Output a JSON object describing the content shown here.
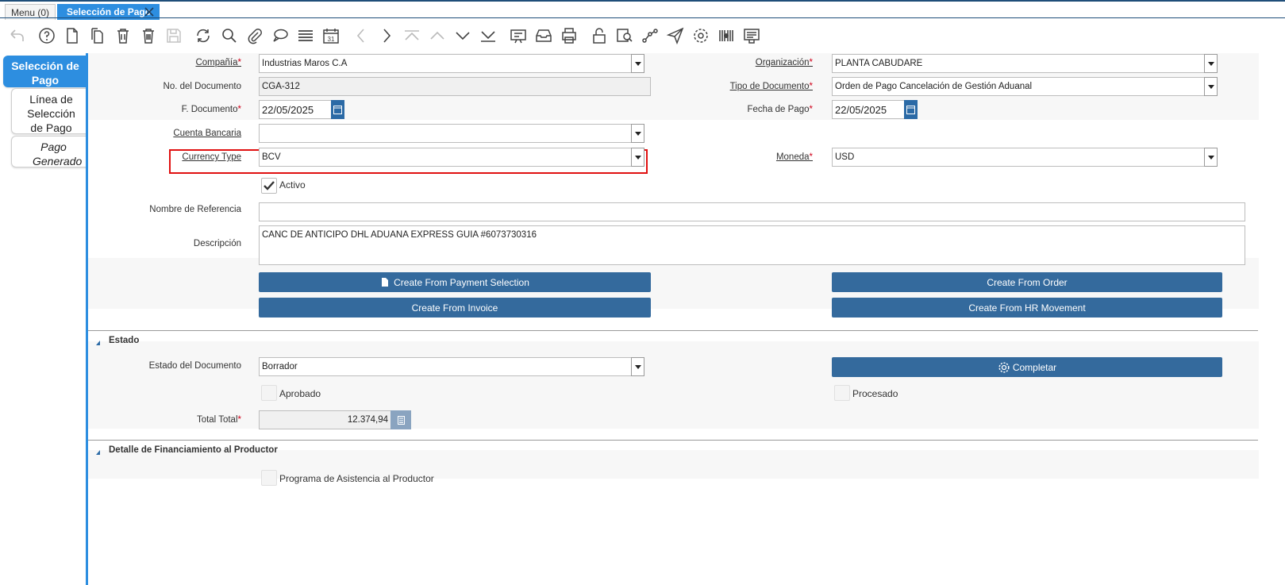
{
  "tabs": {
    "menu": "Menu (0)",
    "active": "Selección de Pago"
  },
  "left_nav": {
    "items": [
      {
        "label": "Selección de Pago"
      },
      {
        "label": "Línea de Selección de Pago"
      },
      {
        "label": "Pago Generado"
      }
    ]
  },
  "form": {
    "compania": {
      "label": "Compañía",
      "value": "Industrias Maros C.A"
    },
    "organizacion": {
      "label": "Organización",
      "value": "PLANTA CABUDARE"
    },
    "no_documento": {
      "label": "No. del Documento",
      "value": "CGA-312"
    },
    "tipo_documento": {
      "label": "Tipo de Documento",
      "value": "Orden de Pago Cancelación de Gestión Aduanal"
    },
    "f_documento": {
      "label": "F. Documento",
      "value": "22/05/2025"
    },
    "fecha_pago": {
      "label": "Fecha de Pago",
      "value": "22/05/2025"
    },
    "cuenta_bancaria": {
      "label": "Cuenta Bancaria",
      "value": ""
    },
    "currency_type": {
      "label": "Currency Type",
      "value": "BCV"
    },
    "moneda": {
      "label": "Moneda",
      "value": "USD"
    },
    "activo": {
      "label": "Activo",
      "checked": true
    },
    "nombre_referencia": {
      "label": "Nombre de Referencia",
      "value": ""
    },
    "descripcion": {
      "label": "Descripción",
      "value": "CANC DE ANTICIPO DHL ADUANA EXPRESS GUIA #6073730316"
    },
    "buttons": {
      "create_payment_selection": "Create From Payment Selection",
      "create_order": "Create From Order",
      "create_invoice": "Create From Invoice",
      "create_hr_movement": "Create From HR Movement"
    }
  },
  "estado": {
    "title": "Estado",
    "estado_documento": {
      "label": "Estado del Documento",
      "value": "Borrador"
    },
    "completar": "Completar",
    "aprobado": {
      "label": "Aprobado",
      "checked": false
    },
    "procesado": {
      "label": "Procesado",
      "checked": false
    },
    "total": {
      "label": "Total Total",
      "value": "12.374,94"
    }
  },
  "financiamiento": {
    "title": "Detalle de Financiamiento al Productor",
    "programa": {
      "label": "Programa de Asistencia al Productor",
      "checked": false
    }
  },
  "colors": {
    "accent": "#2d8ee0",
    "button": "#346a9d",
    "highlight": "#e01010"
  }
}
